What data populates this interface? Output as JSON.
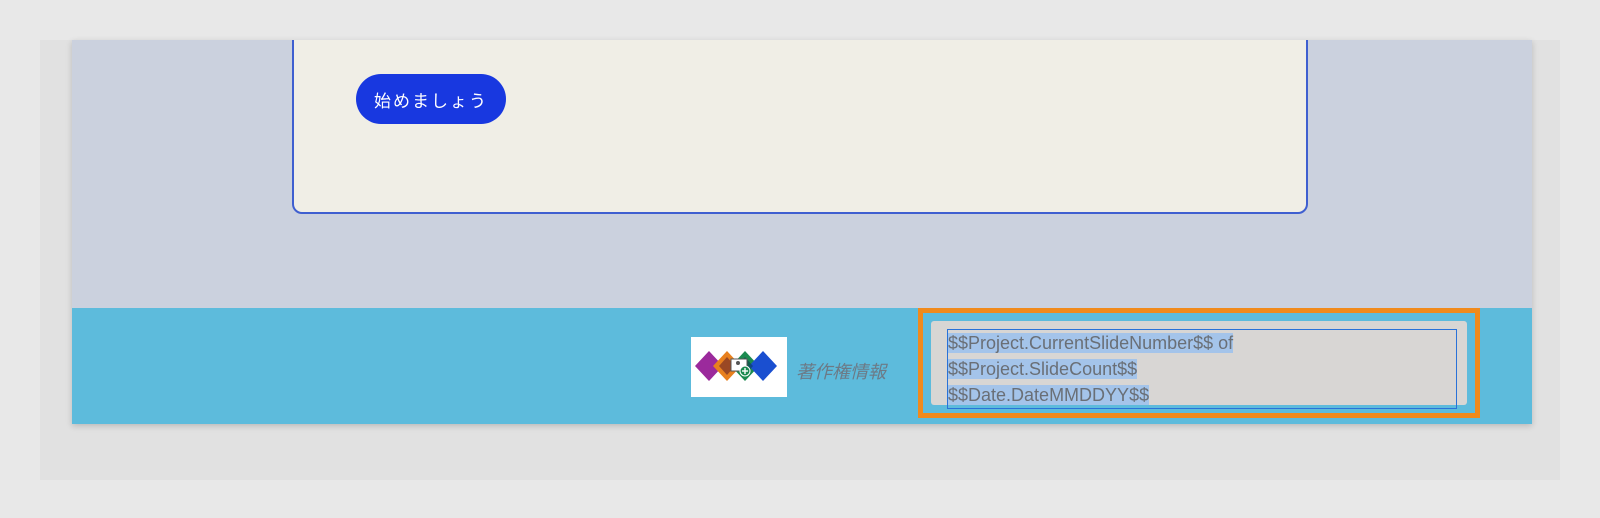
{
  "slide": {
    "start_button_label": "始めましょう",
    "footer": {
      "copyright_label": "著作権情報",
      "logo_icon": "placeholder-logo-icon",
      "variable_lines": [
        "$$Project.CurrentSlideNumber$$ of",
        "$$Project.SlideCount$$",
        "$$Date.DateMMDDYY$$"
      ],
      "selection_highlight_color": "#a4c4ea",
      "selection_frame_color": "#f08a1c"
    }
  },
  "colors": {
    "button_bg": "#1838e0",
    "footer_band": "#5dbbdc",
    "slide_bg": "#cbd1de",
    "card_bg": "#f0eee6"
  }
}
